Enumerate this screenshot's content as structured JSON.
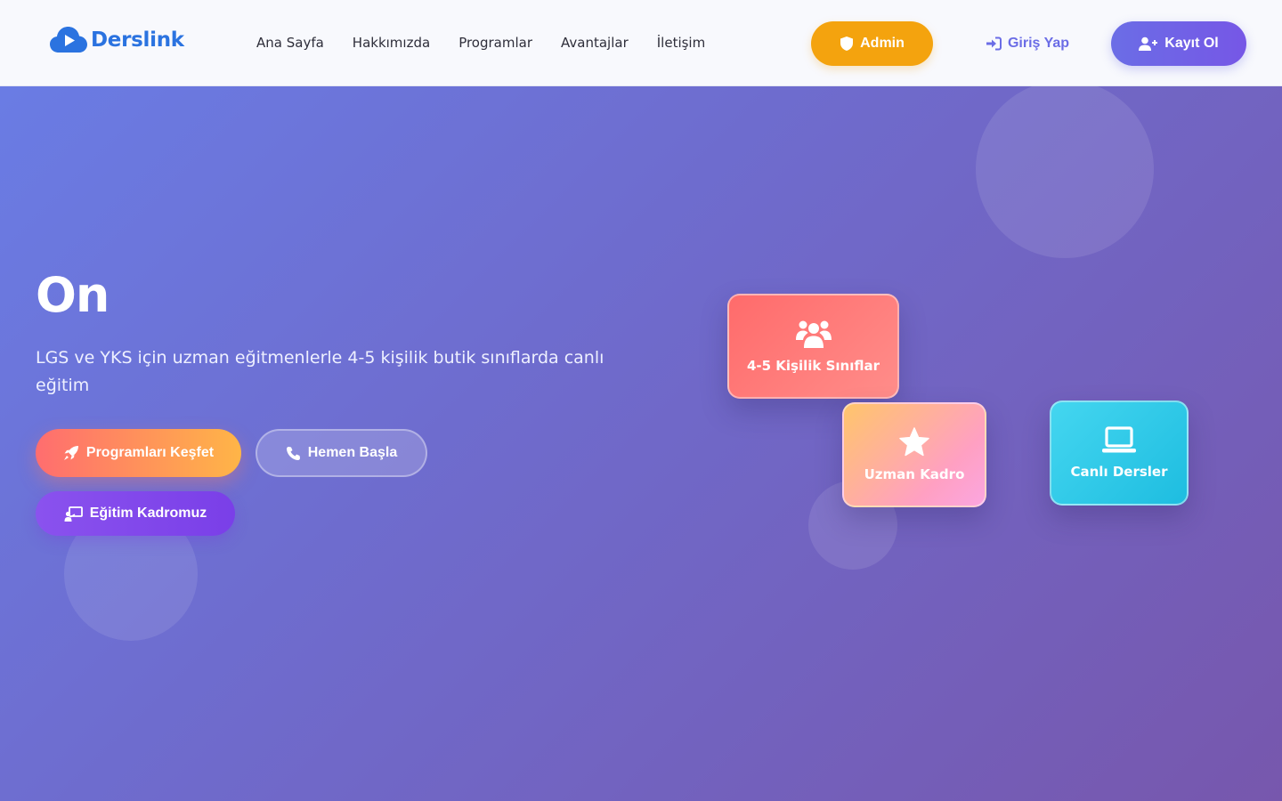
{
  "header": {
    "logo_text": "Derslink",
    "nav": [
      {
        "label": "Ana Sayfa"
      },
      {
        "label": "Hakkımızda"
      },
      {
        "label": "Programlar"
      },
      {
        "label": "Avantajlar"
      },
      {
        "label": "İletişim"
      }
    ],
    "admin_label": "Admin",
    "login_label": "Giriş Yap",
    "register_label": "Kayıt Ol"
  },
  "hero": {
    "title": "On",
    "subtitle": "LGS ve YKS için uzman eğitmenlerle 4-5 kişilik butik sınıflarda canlı eğitim",
    "buttons": {
      "explore": "Programları Keşfet",
      "start": "Hemen Başla",
      "team": "Eğitim Kadromuz"
    },
    "cards": [
      {
        "label": "4-5 Kişilik Sınıflar",
        "icon": "users-icon"
      },
      {
        "label": "Uzman Kadro",
        "icon": "star-icon"
      },
      {
        "label": "Canlı Dersler",
        "icon": "laptop-icon"
      }
    ]
  },
  "colors": {
    "brand": "#2b73e0",
    "admin": "#f4a30e",
    "accent": "#6b6de6"
  }
}
